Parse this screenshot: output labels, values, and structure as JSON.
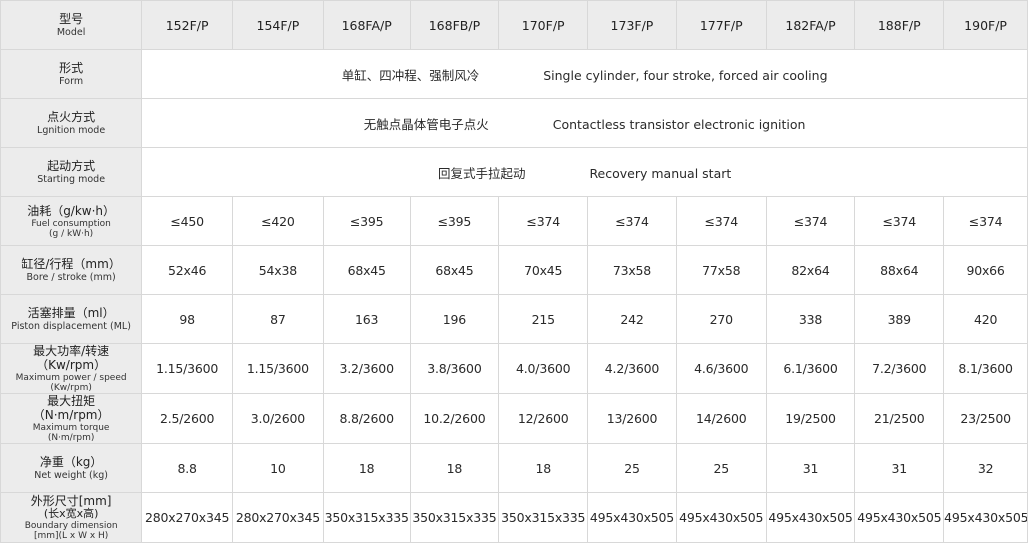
{
  "models": {
    "header_cn": "型号",
    "header_en": "Model",
    "values": [
      "152F/P",
      "154F/P",
      "168FA/P",
      "168FB/P",
      "170F/P",
      "173F/P",
      "177F/P",
      "182FA/P",
      "188F/P",
      "190F/P"
    ]
  },
  "form": {
    "label_cn": "形式",
    "label_en": "Form",
    "value_cn": "单缸、四冲程、强制风冷",
    "value_en": "Single cylinder, four stroke, forced air cooling"
  },
  "ignition": {
    "label_cn": "点火方式",
    "label_en": "Lgnition mode",
    "value_cn": "无触点晶体管电子点火",
    "value_en": "Contactless transistor electronic ignition"
  },
  "starting": {
    "label_cn": "起动方式",
    "label_en": "Starting mode",
    "value_cn": "回复式手拉起动",
    "value_en": "Recovery manual start"
  },
  "fuel": {
    "label_cn": "油耗（g/kw·h）",
    "label_en1": "Fuel consumption",
    "label_en2": "(g / kW·h)",
    "values": [
      "≤450",
      "≤420",
      "≤395",
      "≤395",
      "≤374",
      "≤374",
      "≤374",
      "≤374",
      "≤374",
      "≤374"
    ]
  },
  "bore": {
    "label_cn": "缸径/行程（mm）",
    "label_en": "Bore / stroke (mm)",
    "values": [
      "52x46",
      "54x38",
      "68x45",
      "68x45",
      "70x45",
      "73x58",
      "77x58",
      "82x64",
      "88x64",
      "90x66"
    ]
  },
  "displacement": {
    "label_cn": "活塞排量（ml）",
    "label_en": "Piston displacement (ML)",
    "values": [
      "98",
      "87",
      "163",
      "196",
      "215",
      "242",
      "270",
      "338",
      "389",
      "420"
    ]
  },
  "power": {
    "label_cn1": "最大功率/转速",
    "label_cn2": "（Kw/rpm）",
    "label_en1": "Maximum power / speed",
    "label_en2": "(Kw/rpm)",
    "values": [
      "1.15/3600",
      "1.15/3600",
      "3.2/3600",
      "3.8/3600",
      "4.0/3600",
      "4.2/3600",
      "4.6/3600",
      "6.1/3600",
      "7.2/3600",
      "8.1/3600"
    ]
  },
  "torque": {
    "label_cn1": "最大扭矩",
    "label_cn2": "（N·m/rpm）",
    "label_en1": "Maximum torque",
    "label_en2": "(N·m/rpm)",
    "values": [
      "2.5/2600",
      "3.0/2600",
      "8.8/2600",
      "10.2/2600",
      "12/2600",
      "13/2600",
      "14/2600",
      "19/2500",
      "21/2500",
      "23/2500"
    ]
  },
  "weight": {
    "label_cn": "净重（kg）",
    "label_en": "Net weight (kg)",
    "values": [
      "8.8",
      "10",
      "18",
      "18",
      "18",
      "25",
      "25",
      "31",
      "31",
      "32"
    ]
  },
  "dimension": {
    "label_cn1": "外形尺寸[mm]",
    "label_cn2": "(长x宽x高)",
    "label_en1": "Boundary dimension",
    "label_en2": "[mm](L x W x H)",
    "values": [
      "280x270x345",
      "280x270x345",
      "350x315x335",
      "350x315x335",
      "350x315x335",
      "495x430x505",
      "495x430x505",
      "495x430x505",
      "495x430x505",
      "495x430x505"
    ]
  }
}
